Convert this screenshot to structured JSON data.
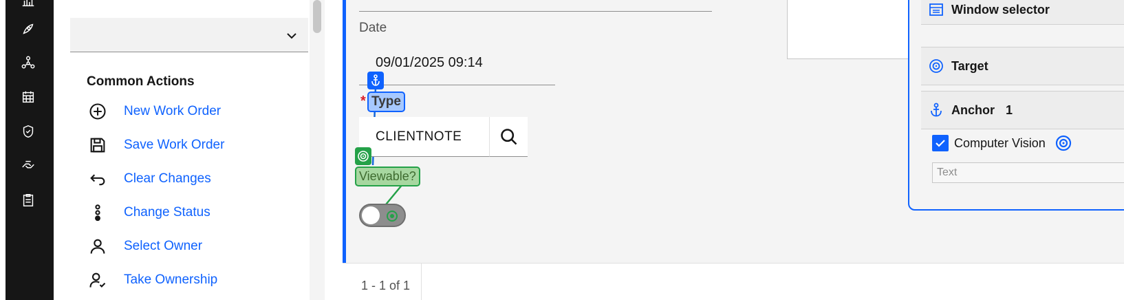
{
  "rail": {
    "icons": [
      "chart-bar-icon",
      "rocket-icon",
      "network-icon",
      "calendar-icon",
      "shield-check-icon",
      "hands-icon",
      "clipboard-icon"
    ]
  },
  "actions": {
    "title": "Common Actions",
    "items": [
      {
        "label": "New Work Order",
        "icon": "add-circle-icon"
      },
      {
        "label": "Save Work Order",
        "icon": "save-icon"
      },
      {
        "label": "Clear Changes",
        "icon": "undo-icon"
      },
      {
        "label": "Change Status",
        "icon": "status-dots-icon"
      },
      {
        "label": "Select Owner",
        "icon": "user-icon"
      },
      {
        "label": "Take Ownership",
        "icon": "user-check-icon"
      }
    ]
  },
  "form": {
    "date_label": "Date",
    "date_value": "09/01/2025 09:14",
    "type_required": "*",
    "type_label": "Type",
    "type_value": "CLIENTNOTE",
    "viewable_label": "Viewable?",
    "viewable_on": false
  },
  "footer": {
    "pager": "1 - 1 of 1"
  },
  "selector": {
    "window_selector": "Window selector",
    "target": "Target",
    "anchor": "Anchor",
    "anchor_count": "1",
    "computer_vision": "Computer Vision",
    "computer_vision_checked": true,
    "text_placeholder": "Text"
  },
  "colors": {
    "accent": "#0f62fe",
    "target_green": "#24a148",
    "required_red": "#da1e28",
    "rail_bg": "#161616"
  }
}
